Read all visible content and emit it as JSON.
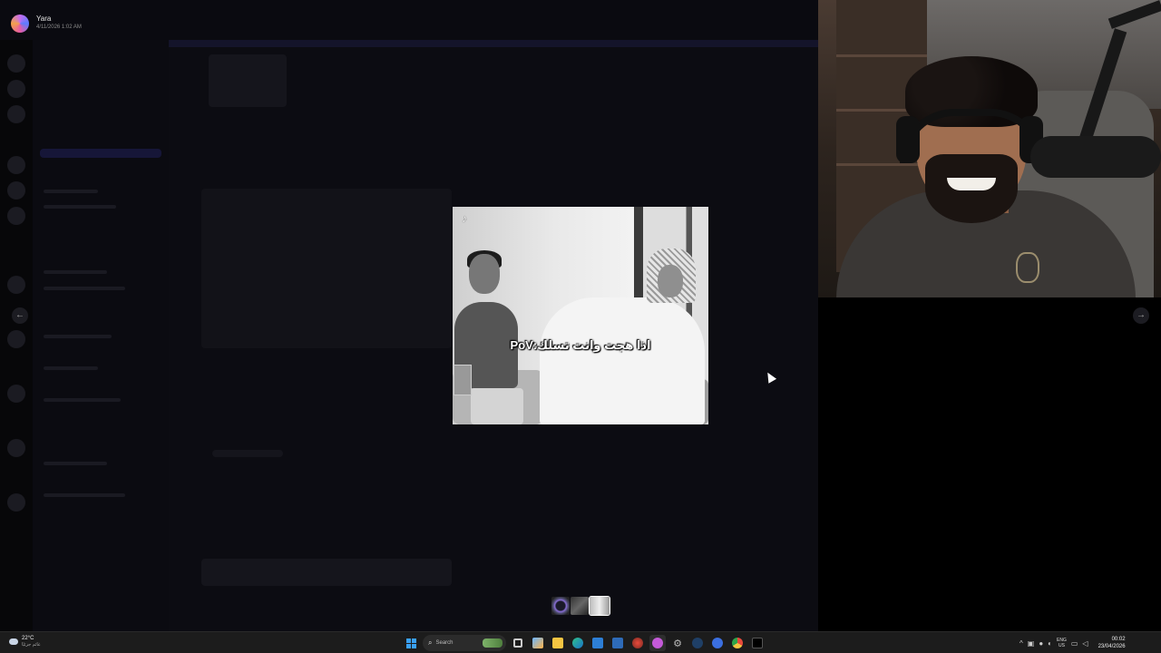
{
  "viewer": {
    "uploader_name": "Yara",
    "uploader_date": "4/11/2026 1:02 AM",
    "prev_glyph": "←",
    "next_glyph": "→"
  },
  "media": {
    "caption": "اذا هجت وانت تسلك:PoV",
    "watermark_icon": "tiktok-icon"
  },
  "thumbnails": [
    "thumb-1",
    "thumb-2",
    "thumb-3"
  ],
  "taskbar": {
    "weather_temp": "22°C",
    "weather_condition": "غائم جزئيًا",
    "search_placeholder": "Search",
    "search_glyph": "⌕",
    "language_top": "ENG",
    "language_bottom": "US",
    "time": "00:02",
    "date": "23/04/2026",
    "tray_up_glyph": "^"
  },
  "colors": {
    "windows_blue": "#3aa0f3",
    "backdrop": "#000000"
  }
}
